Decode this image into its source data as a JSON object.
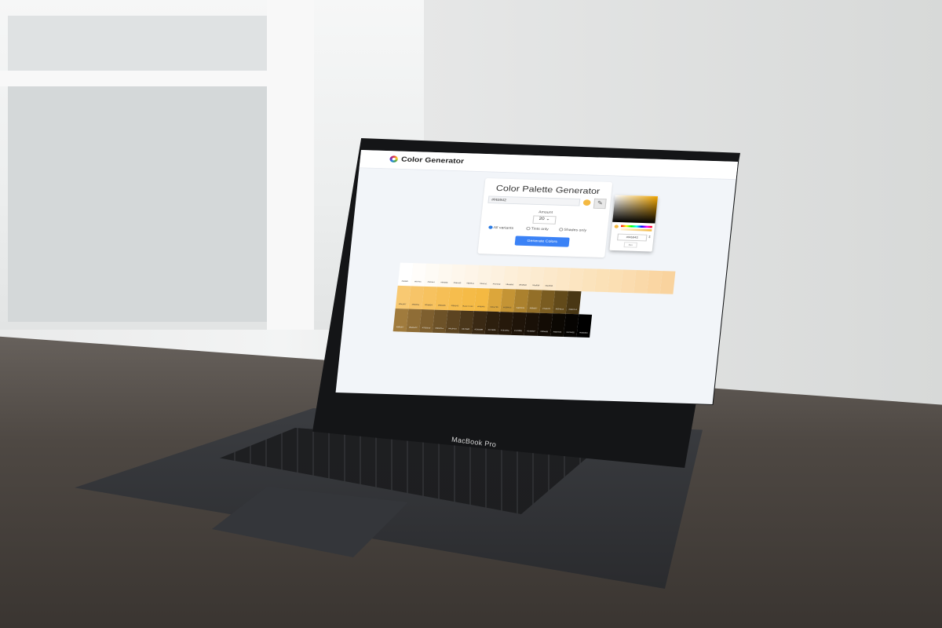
{
  "app": {
    "title": "Color Generator"
  },
  "card": {
    "title": "Color Palette Generator",
    "color_value": "#f4b942",
    "amount_label": "Amount",
    "amount_value": "20",
    "amount_chevron": "⌄",
    "radio_all": "All variants",
    "radio_tints": "Tints only",
    "radio_shades": "Shades only",
    "generate_label": "Generate Colors",
    "picker_glyph": "✎"
  },
  "picker": {
    "hex": "#f4b942",
    "mode": "hex",
    "spin_glyph": "⇕"
  },
  "device": {
    "brand": "MacBook Pro"
  },
  "palette": {
    "tints": [
      "#ffffff",
      "#fffdfa",
      "#fefbf5",
      "#fef9f0",
      "#fef7ec",
      "#fef5e8",
      "#fdf3e3",
      "#fdf1df",
      "#fdefd9",
      "#fdedd4",
      "#fcebd0",
      "#fce9cb",
      "#fce7c6",
      "#fce5c1",
      "#fbe3bc",
      "#fbe1b7",
      "#fbdfb3",
      "#fbdcaf",
      "#fad9a9",
      "#fad6a3",
      "#f9d39e"
    ],
    "tints_labels": [
      "#fefbf5",
      "#fef7ec",
      "#fef4e4",
      "#fef0db",
      "#fdecd3",
      "#fde8ca",
      "#fce5c1",
      "#fce1b9",
      "#fbddb0",
      "#fbd9a8",
      "#fad59f",
      "#fad296"
    ],
    "base": [
      "#f8c972",
      "#f7c468",
      "#f7c25f",
      "#f6bf56",
      "#f6bd4d",
      "#f5bb47",
      "#f4b942",
      "#dca63b",
      "#c49435",
      "#ab812e",
      "#936f28",
      "#7a5c21",
      "#624a1a",
      "#493714"
    ],
    "base_labels": [
      "#f6c567",
      "#f6c05e",
      "#f5bd54",
      "#f5b94b",
      "#f5b542",
      "Base Color",
      "#f4b942",
      "#dca73b",
      "#c39435",
      "#ab812e",
      "#936f27",
      "#7a5c21",
      "#624a1a",
      "#493714"
    ],
    "shades": [
      "#a07b3d",
      "#8f6d36",
      "#7e5f2f",
      "#6d5228",
      "#5c4421",
      "#4b371b",
      "#3a2914",
      "#2d1f0e",
      "#26190b",
      "#1f1409",
      "#191007",
      "#130c05",
      "#0c0803",
      "#060402",
      "#000000"
    ],
    "shades_labels": [
      "#9f6d27",
      "#8a5e22",
      "#75501d",
      "#60421a",
      "#4c3414",
      "#37260f",
      "#231809",
      "#1f150b",
      "#1b120a",
      "#170f08",
      "#130d07",
      "#0f0a05",
      "#0b0704",
      "#070402",
      "#000000"
    ]
  }
}
